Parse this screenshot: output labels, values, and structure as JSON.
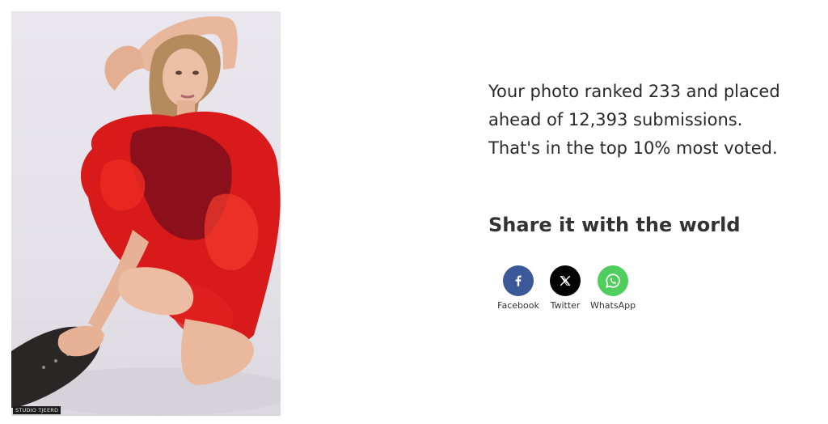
{
  "photo": {
    "watermark": "STUDIO TJEERD"
  },
  "result": {
    "line1": "Your photo ranked 233 and placed",
    "line2": "ahead of 12,393 submissions.",
    "line3": "That's in the top 10% most voted."
  },
  "share": {
    "title": "Share it with the world",
    "buttons": [
      {
        "label": "Facebook",
        "icon": "facebook-icon",
        "color": "#3b5998"
      },
      {
        "label": "Twitter",
        "icon": "x-twitter-icon",
        "color": "#000000"
      },
      {
        "label": "WhatsApp",
        "icon": "whatsapp-icon",
        "color": "#4fce5d"
      }
    ]
  }
}
